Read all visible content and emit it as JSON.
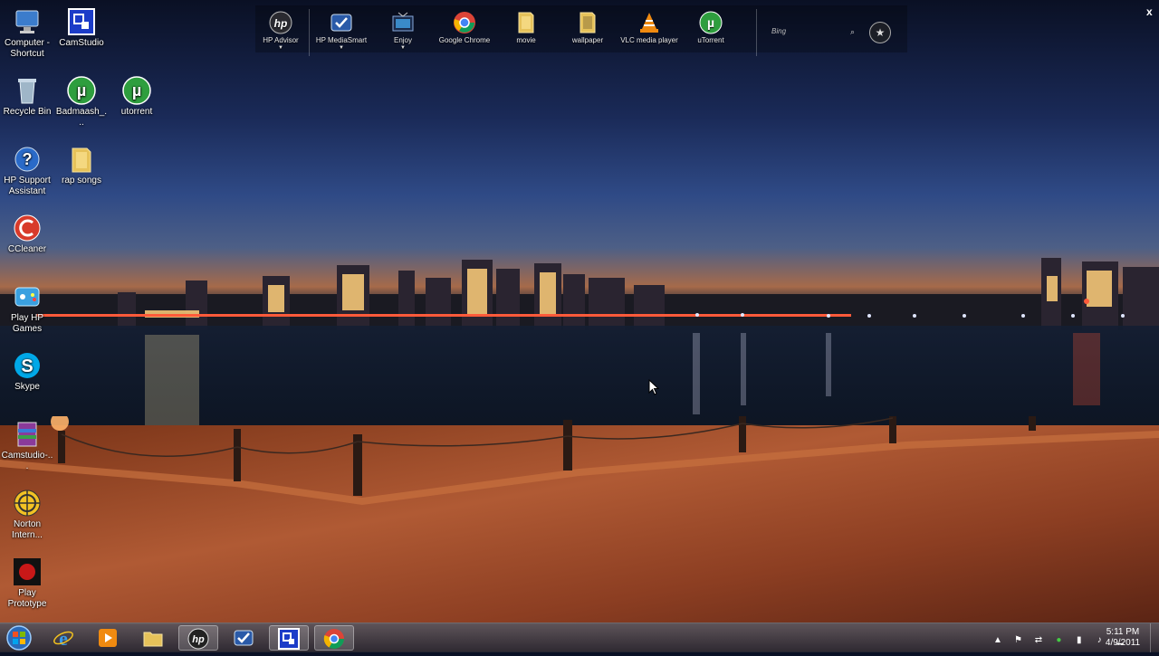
{
  "desktop_icons": [
    {
      "label": "Computer - Shortcut",
      "icon": "computer-icon"
    },
    {
      "label": "CamStudio",
      "icon": "camstudio-icon"
    },
    {
      "label": "Recycle Bin",
      "icon": "recycle-bin-icon"
    },
    {
      "label": "Badmaash_...",
      "icon": "utorrent-icon"
    },
    {
      "label": "utorrent",
      "icon": "utorrent-icon"
    },
    {
      "label": "HP Support Assistant",
      "icon": "help-icon"
    },
    {
      "label": "rap songs",
      "icon": "folder-icon"
    },
    {
      "label": "CCleaner",
      "icon": "ccleaner-icon"
    },
    {
      "label": "Play HP Games",
      "icon": "games-icon"
    },
    {
      "label": "Skype",
      "icon": "skype-icon"
    },
    {
      "label": "Camstudio-...",
      "icon": "winrar-icon"
    },
    {
      "label": "Norton Intern...",
      "icon": "norton-icon"
    },
    {
      "label": "Play Prototype",
      "icon": "prototype-icon"
    }
  ],
  "dock": {
    "items": [
      {
        "label": "HP Advisor",
        "icon": "hp-icon",
        "has_menu": true
      },
      {
        "label": "HP MediaSmart",
        "icon": "mediasmart-icon",
        "has_menu": true
      },
      {
        "label": "Enjoy",
        "icon": "tv-icon",
        "has_menu": true
      },
      {
        "label": "Google Chrome",
        "icon": "chrome-icon",
        "has_menu": false
      },
      {
        "label": "movie",
        "icon": "folder-icon",
        "has_menu": false
      },
      {
        "label": "wallpaper",
        "icon": "folder-icon",
        "has_menu": false
      },
      {
        "label": "VLC media player",
        "icon": "vlc-icon",
        "has_menu": false
      },
      {
        "label": "uTorrent",
        "icon": "utorrent-icon",
        "has_menu": false
      }
    ],
    "search_placeholder": "Bing",
    "close_label": "x"
  },
  "taskbar": {
    "pinned": [
      {
        "name": "internet-explorer",
        "icon": "ie-icon"
      },
      {
        "name": "media-player",
        "icon": "media-player-icon"
      },
      {
        "name": "file-explorer",
        "icon": "folder-icon"
      },
      {
        "name": "hp-advisor",
        "icon": "hp-icon"
      },
      {
        "name": "hp-mediasmart",
        "icon": "mediasmart-icon"
      },
      {
        "name": "camstudio",
        "icon": "camstudio-icon"
      },
      {
        "name": "google-chrome",
        "icon": "chrome-icon"
      }
    ],
    "clock_time": "5:11 PM",
    "clock_date": "4/9/2011"
  },
  "colors": {
    "taskbar": "#3a3a46",
    "utorrent_green": "#2e9e3e",
    "hp_blue": "#1b5aa8"
  }
}
